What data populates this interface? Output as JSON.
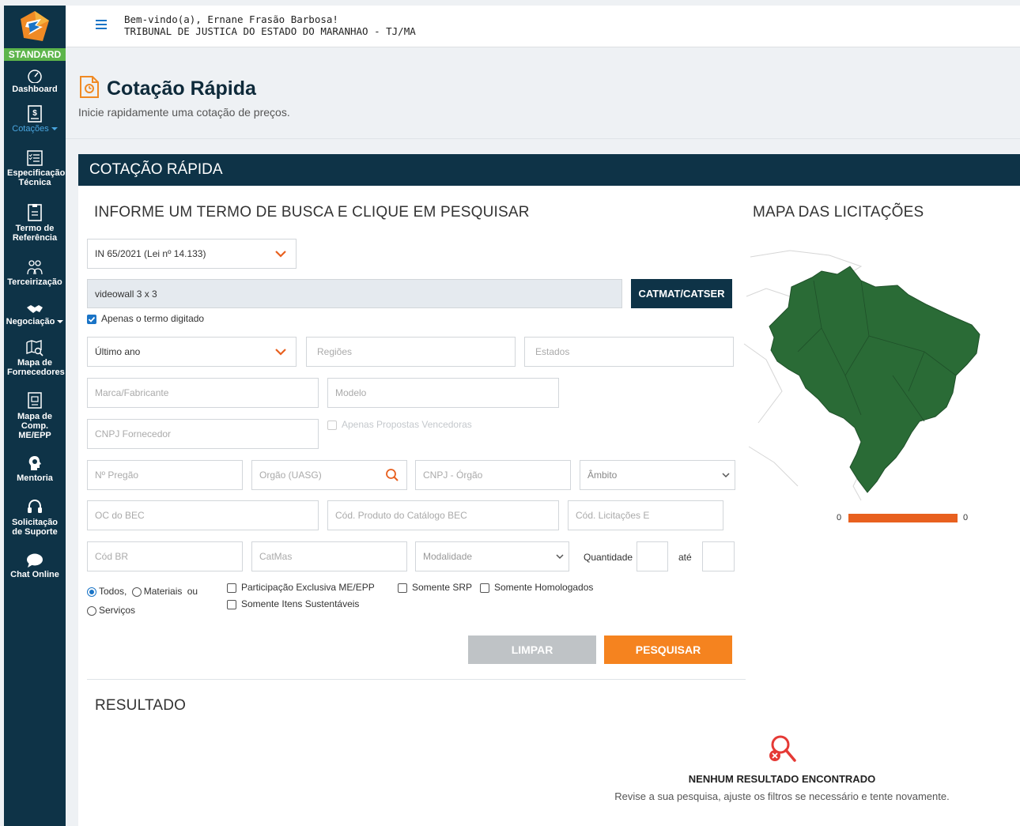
{
  "app": {
    "badge": "STANDARD"
  },
  "sidebar": {
    "items": [
      {
        "label": "Dashboard"
      },
      {
        "label": "Cotações"
      },
      {
        "label": "Especificação Técnica"
      },
      {
        "label": "Termo de Referência"
      },
      {
        "label": "Terceirização"
      },
      {
        "label": "Negociação"
      },
      {
        "label": "Mapa de Fornecedores"
      },
      {
        "label": "Mapa de Comp. ME/EPP"
      },
      {
        "label": "Mentoria"
      },
      {
        "label": "Solicitação de Suporte"
      },
      {
        "label": "Chat Online"
      }
    ]
  },
  "header": {
    "welcome": "Bem-vindo(a), Ernane Frasão Barbosa!",
    "org": "TRIBUNAL DE JUSTICA DO ESTADO DO MARANHAO - TJ/MA"
  },
  "page": {
    "title": "Cotação Rápida",
    "subtitle": "Inicie rapidamente uma cotação de preços."
  },
  "card": {
    "header": "COTAÇÃO RÁPIDA"
  },
  "form": {
    "section_title": "INFORME UM TERMO DE BUSCA E CLIQUE EM PESQUISAR",
    "law_select": "IN 65/2021 (Lei nº 14.133)",
    "search_value": "videowall 3 x 3",
    "catmat_button": "CATMAT/CATSER",
    "only_term_label": "Apenas o termo digitado",
    "period_select": "Último ano",
    "regions_placeholder": "Regiões",
    "states_placeholder": "Estados",
    "brand_placeholder": "Marca/Fabricante",
    "model_placeholder": "Modelo",
    "cnpj_supplier_placeholder": "CNPJ Fornecedor",
    "winning_only_label": "Apenas Propostas Vencedoras",
    "pregao_placeholder": "Nº Pregão",
    "orgao_placeholder": "Orgão (UASG)",
    "cnpj_orgao_placeholder": "CNPJ - Órgão",
    "ambito_placeholder": "Âmbito",
    "oc_bec_placeholder": "OC do BEC",
    "cod_produto_placeholder": "Cód. Produto do Catálogo BEC",
    "cod_licitacoes_placeholder": "Cód. Licitações E",
    "cod_br_placeholder": "Cód BR",
    "catmas_placeholder": "CatMas",
    "modalidade_placeholder": "Modalidade",
    "quantidade_label": "Quantidade",
    "ate_label": "até",
    "radio_todos": "Todos,",
    "radio_materiais": "Materiais",
    "ou_label": "ou",
    "radio_servicos": "Serviços",
    "chk_me_epp": "Participação Exclusiva ME/EPP",
    "chk_sustentaveis": "Somente Itens Sustentáveis",
    "chk_srp": "Somente SRP",
    "chk_homologados": "Somente Homologados",
    "clear_button": "LIMPAR",
    "search_button": "PESQUISAR"
  },
  "map": {
    "title": "MAPA DAS LICITAÇÕES",
    "legend_min": "0",
    "legend_max": "0",
    "fill_color": "#2a6b36",
    "legend_color": "#e8601f"
  },
  "result": {
    "title": "RESULTADO",
    "empty_title": "NENHUM RESULTADO ENCONTRADO",
    "empty_sub": "Revise a sua pesquisa, ajuste os filtros se necessário e tente novamente."
  }
}
